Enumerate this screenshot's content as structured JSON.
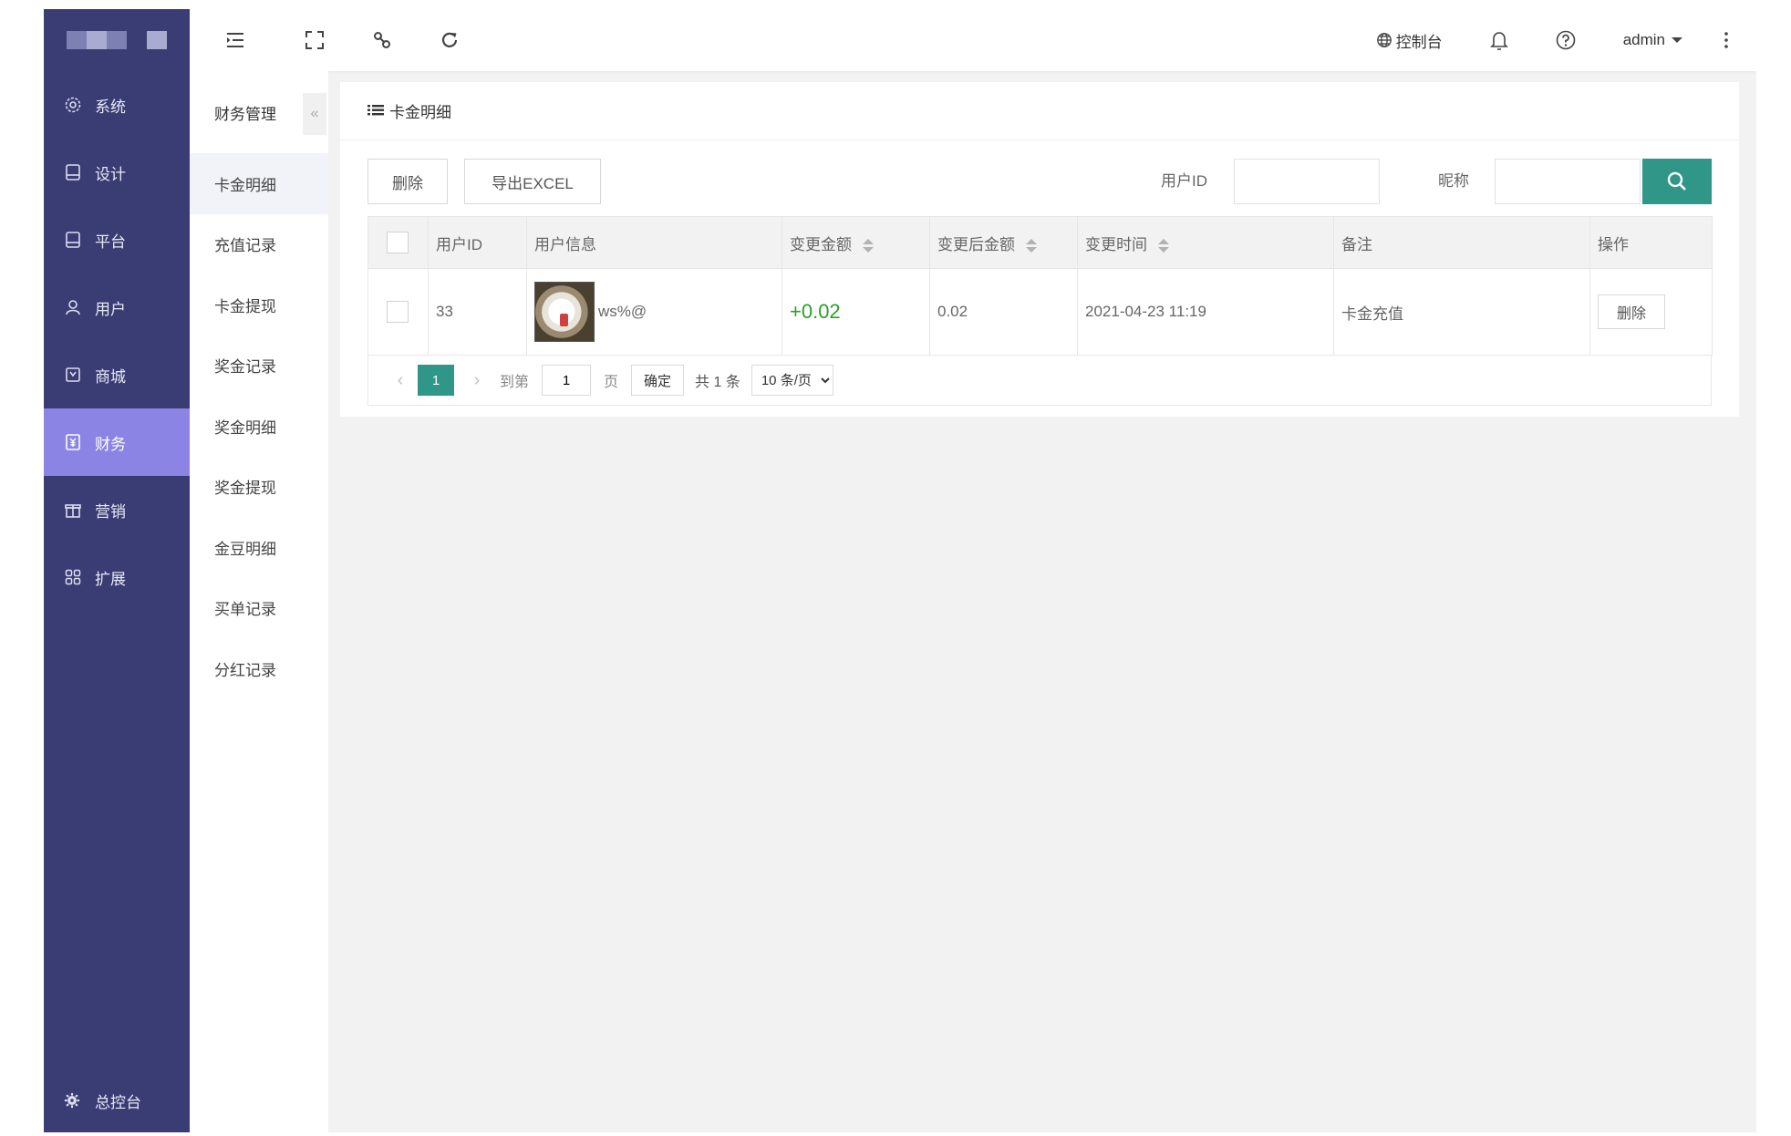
{
  "sidebar": {
    "items": [
      {
        "label": "系统",
        "icon": "gear-icon"
      },
      {
        "label": "设计",
        "icon": "design-icon"
      },
      {
        "label": "平台",
        "icon": "platform-icon"
      },
      {
        "label": "用户",
        "icon": "user-icon"
      },
      {
        "label": "商城",
        "icon": "shop-icon"
      },
      {
        "label": "财务",
        "icon": "finance-icon",
        "active": true
      },
      {
        "label": "营销",
        "icon": "gift-icon"
      },
      {
        "label": "扩展",
        "icon": "grid-icon"
      }
    ],
    "bottom_label": "总控台",
    "colors": {
      "bg": "#393d73",
      "active": "#8c84e5"
    }
  },
  "subsidebar": {
    "title": "财务管理",
    "collapse_glyph": "«",
    "items": [
      {
        "label": "卡金明细",
        "active": true
      },
      {
        "label": "充值记录"
      },
      {
        "label": "卡金提现"
      },
      {
        "label": "奖金记录"
      },
      {
        "label": "奖金明细"
      },
      {
        "label": "奖金提现"
      },
      {
        "label": "金豆明细"
      },
      {
        "label": "买单记录"
      },
      {
        "label": "分红记录"
      }
    ]
  },
  "header": {
    "console_label": "控制台",
    "user_label": "admin"
  },
  "panel": {
    "title": "卡金明细",
    "toolbar": {
      "delete_label": "删除",
      "export_label": "导出EXCEL",
      "userid_label": "用户ID",
      "nickname_label": "昵称",
      "userid_value": "",
      "nickname_value": ""
    },
    "table": {
      "headers": [
        "用户ID",
        "用户信息",
        "变更金额",
        "变更后金额",
        "变更时间",
        "备注",
        "操作"
      ],
      "rows": [
        {
          "user_id": "33",
          "nickname": "ws%@",
          "change": "+0.02",
          "after": "0.02",
          "time": "2021-04-23 11:19",
          "note": "卡金充值",
          "action": "删除"
        }
      ]
    },
    "pager": {
      "prev": "‹",
      "next": "›",
      "current": "1",
      "goto_label": "到第",
      "goto_value": "1",
      "page_unit": "页",
      "confirm_label": "确定",
      "total_label": "共 1 条",
      "page_size": "10 条/页",
      "accent": "#2f9688"
    }
  }
}
